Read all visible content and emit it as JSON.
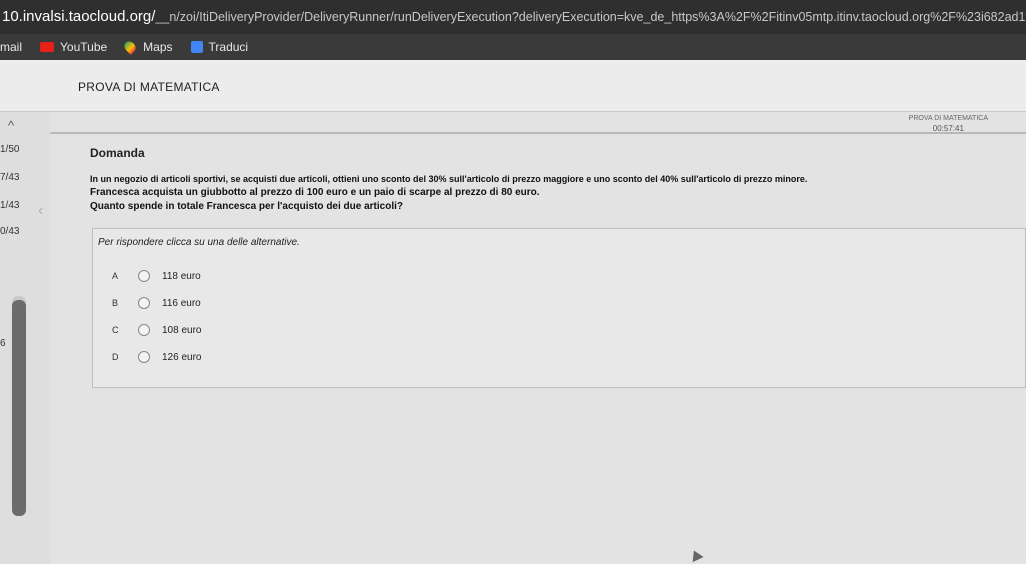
{
  "browser": {
    "url_host": "10.invalsi.taocloud.org/",
    "url_path": "__n/zoi/ItiDeliveryProvider/DeliveryRunner/runDeliveryExecution?deliveryExecution=kve_de_https%3A%2F%2Fitinv05mtp.itinv.taocloud.org%2F%23i682ad1fa8fa6f202505190838501103a28d",
    "bookmarks": [
      {
        "label": "mail",
        "icon": "mail-icon"
      },
      {
        "label": "YouTube",
        "icon": "youtube-icon"
      },
      {
        "label": "Maps",
        "icon": "maps-icon"
      },
      {
        "label": "Traduci",
        "icon": "translate-icon"
      }
    ]
  },
  "test": {
    "title": "PROVA DI MATEMATICA",
    "info_title": "PROVA DI MATEMATICA",
    "timer": "00:57:41"
  },
  "sidebar": {
    "items": [
      "1/50",
      "7/43",
      "1/43",
      "0/43"
    ],
    "section_number": "6"
  },
  "question": {
    "label": "Domanda",
    "line1": "In un negozio di articoli sportivi, se acquisti due articoli, ottieni uno sconto del 30% sull'articolo di prezzo maggiore e uno sconto del 40% sull'articolo di prezzo minore.",
    "line2": "Francesca acquista un giubbotto al prezzo di 100 euro e un paio di scarpe al prezzo di 80 euro.",
    "line3": "Quanto spende in totale Francesca per l'acquisto dei due articoli?",
    "prompt": "Per rispondere clicca su una delle alternative.",
    "options": [
      {
        "letter": "A",
        "text": "118 euro"
      },
      {
        "letter": "B",
        "text": "116 euro"
      },
      {
        "letter": "C",
        "text": "108 euro"
      },
      {
        "letter": "D",
        "text": "126 euro"
      }
    ]
  }
}
